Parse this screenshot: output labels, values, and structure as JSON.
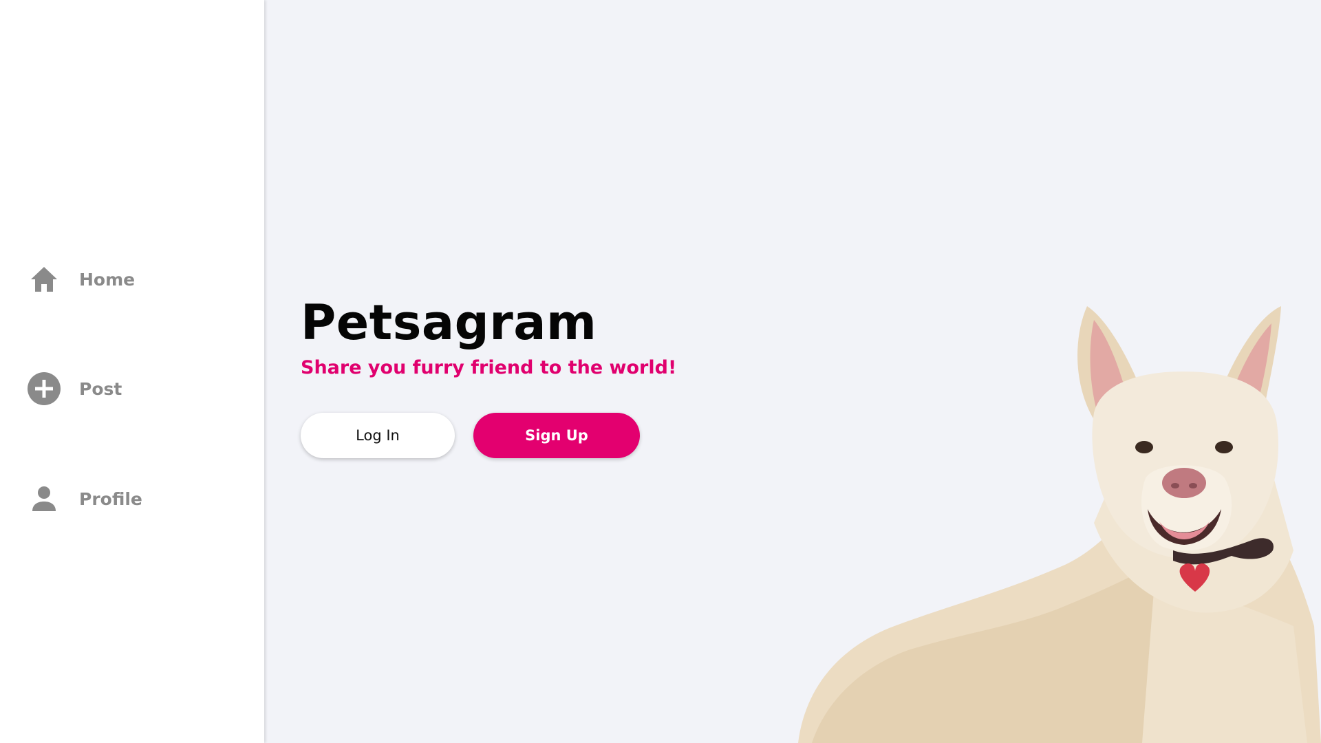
{
  "sidebar": {
    "items": [
      {
        "label": "Home",
        "icon": "home-icon"
      },
      {
        "label": "Post",
        "icon": "add-circle-icon"
      },
      {
        "label": "Profile",
        "icon": "person-icon"
      }
    ]
  },
  "hero": {
    "title": "Petsagram",
    "tagline": "Share you furry friend to the world!",
    "login_label": "Log In",
    "signup_label": "Sign Up"
  },
  "colors": {
    "accent": "#e3006f",
    "nav_gray": "#8a8a8a",
    "background": "#f2f3f8",
    "sidebar": "#ffffff"
  }
}
